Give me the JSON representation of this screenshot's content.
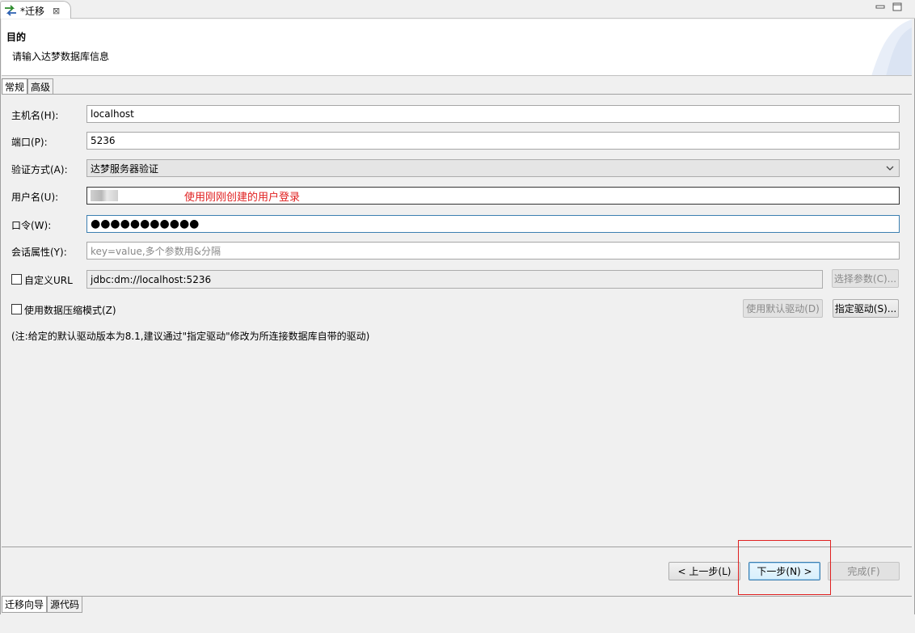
{
  "editor_tab": {
    "title": "*迁移",
    "close": "⊠"
  },
  "header": {
    "title": "目的",
    "description": "请输入达梦数据库信息"
  },
  "subtabs": [
    {
      "label": "常规"
    },
    {
      "label": "高级"
    }
  ],
  "form": {
    "host": {
      "label": "主机名(H):",
      "value": "localhost"
    },
    "port": {
      "label": "端口(P):",
      "value": "5236"
    },
    "auth": {
      "label": "验证方式(A):",
      "value": "达梦服务器验证"
    },
    "username": {
      "label": "用户名(U):",
      "annotation": "使用刚刚创建的用户登录"
    },
    "password": {
      "label": "口令(W):",
      "value": "●●●●●●●●●●●"
    },
    "session": {
      "label": "会话属性(Y):",
      "placeholder": "key=value,多个参数用&分隔"
    },
    "custom_url": {
      "label": "自定义URL",
      "value": "jdbc:dm://localhost:5236",
      "checked": false
    },
    "compression": {
      "label": "使用数据压缩模式(Z)",
      "checked": false
    }
  },
  "buttons": {
    "select_params": "选择参数(C)...",
    "default_driver": "使用默认驱动(D)",
    "specify_driver": "指定驱动(S)...",
    "back": "< 上一步(L)",
    "next": "下一步(N) >",
    "finish": "完成(F)"
  },
  "note": "(注:给定的默认驱动版本为8.1,建议通过\"指定驱动\"修改为所连接数据库自带的驱动)",
  "bottom_tabs": [
    {
      "label": "迁移向导"
    },
    {
      "label": "源代码"
    }
  ],
  "colors": {
    "annotation": "#e02020",
    "highlight": "#e02020",
    "focus": "#3c7fb1"
  }
}
